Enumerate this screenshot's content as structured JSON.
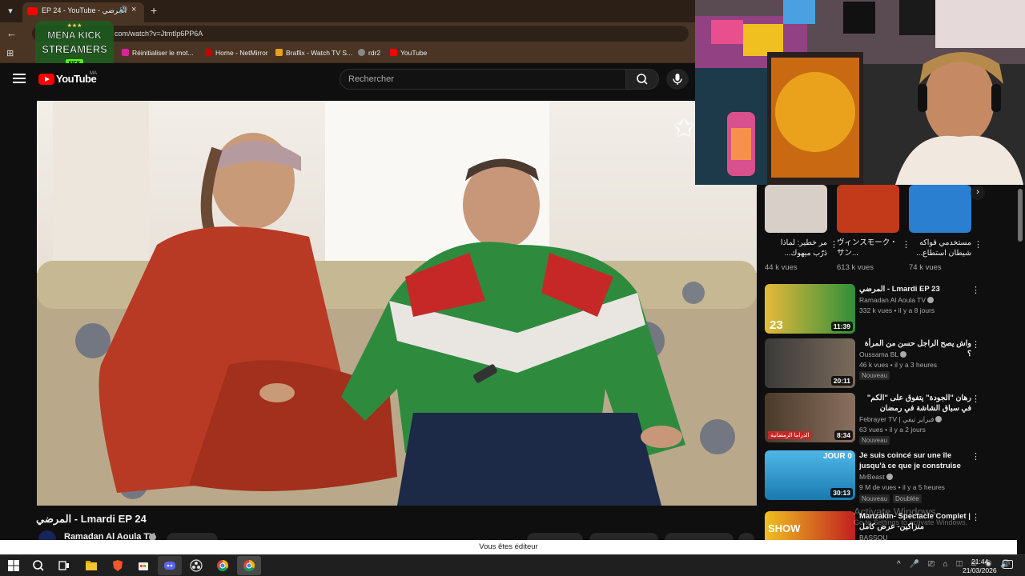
{
  "browser": {
    "tab_title": "EP 24 - YouTube - المرضي",
    "url": "com/watch?v=JtmtIp6PP6A",
    "bookmarks": [
      "Réinitialiser le mot...",
      "Home - NetMirror",
      "Braflix - Watch TV S...",
      "rdr2",
      "YouTube"
    ]
  },
  "overlay": {
    "logo_line1": "MENA KICK",
    "logo_line2": "STREAMERS",
    "logo_sub": "KICK"
  },
  "youtube": {
    "logo_text": "YouTube",
    "country": "MA",
    "search_placeholder": "Rechercher"
  },
  "video": {
    "title": "المرضي - Lmardi EP 24",
    "channel": "Ramadan Al Aoula TV"
  },
  "shorts": [
    {
      "title": "مر خطير: لماذا دَرّب ميهوك...",
      "views": "44 k vues"
    },
    {
      "title": "ヴィンスモーク・サン...",
      "views": "613 k vues"
    },
    {
      "title": "مستخدمي قواكه شيطان استطاع...",
      "views": "74 k vues"
    }
  ],
  "recommended": [
    {
      "title": "المرضي - Lmardi EP 23",
      "channel": "Ramadan Al Aoula TV",
      "meta": "332 k vues • il y a 8 jours",
      "duration": "11:39",
      "badge": "",
      "thumb_text": "23"
    },
    {
      "title": "واش يصح الراجل حسن من المرأة ؟",
      "channel": "Oussama BL",
      "meta": "46 k vues • il y a 3 heures",
      "duration": "20:11",
      "badge": "Nouveau",
      "thumb_text": ""
    },
    {
      "title": "رهان \"الجودة\" يتفوق على \"الكم\" في سباق الشاشة في رمضان",
      "channel": "Febrayer TV | فبراير تيفي",
      "meta": "63 vues • il y a 2 jours",
      "duration": "8:34",
      "badge": "Nouveau",
      "thumb_text": "الدراما الرمضانية"
    },
    {
      "title": "Je suis coincé sur une île jusqu'à ce que je construise un...",
      "channel": "MrBeast",
      "meta": "9 M de vues • il y a 5 heures",
      "duration": "30:13",
      "badge": "Nouveau",
      "badge2": "Doublée",
      "thumb_text": "JOUR 0"
    },
    {
      "title": "Manzakin- Spectacle Complet | منزاكين- عرض كامل",
      "channel": "BASSOU",
      "meta": "",
      "duration": "",
      "badge": "",
      "thumb_text": "SHOW"
    }
  ],
  "windows": {
    "activate_title": "Activate Windows",
    "activate_sub": "Go to Settings to activate Windows.",
    "editor_notice": "Vous êtes éditeur",
    "time": "21:44",
    "date": "21/03/2026"
  }
}
